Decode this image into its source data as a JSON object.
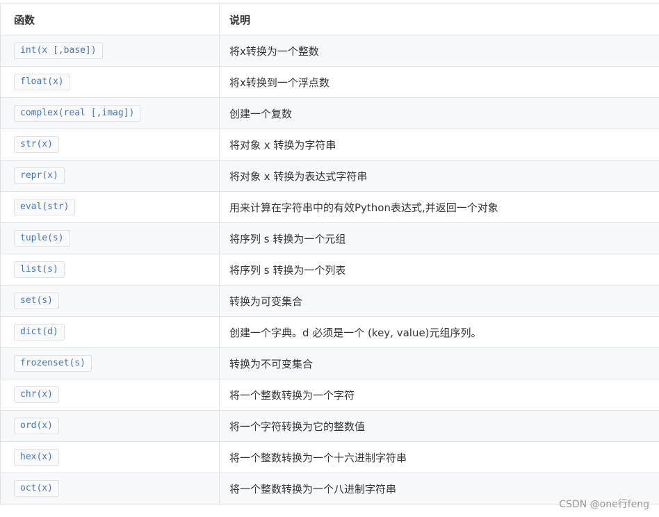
{
  "table": {
    "headers": {
      "function": "函数",
      "description": "说明"
    },
    "rows": [
      {
        "function": "int(x [,base])",
        "description": "将x转换为一个整数"
      },
      {
        "function": "float(x)",
        "description": "将x转换到一个浮点数"
      },
      {
        "function": "complex(real [,imag])",
        "description": "创建一个复数"
      },
      {
        "function": "str(x)",
        "description": "将对象 x 转换为字符串"
      },
      {
        "function": "repr(x)",
        "description": "将对象 x 转换为表达式字符串"
      },
      {
        "function": "eval(str)",
        "description": "用来计算在字符串中的有效Python表达式,并返回一个对象"
      },
      {
        "function": "tuple(s)",
        "description": "将序列 s 转换为一个元组"
      },
      {
        "function": "list(s)",
        "description": "将序列 s 转换为一个列表"
      },
      {
        "function": "set(s)",
        "description": "转换为可变集合"
      },
      {
        "function": "dict(d)",
        "description": "创建一个字典。d 必须是一个 (key, value)元组序列。"
      },
      {
        "function": "frozenset(s)",
        "description": "转换为不可变集合"
      },
      {
        "function": "chr(x)",
        "description": "将一个整数转换为一个字符"
      },
      {
        "function": "ord(x)",
        "description": "将一个字符转换为它的整数值"
      },
      {
        "function": "hex(x)",
        "description": "将一个整数转换为一个十六进制字符串"
      },
      {
        "function": "oct(x)",
        "description": "将一个整数转换为一个八进制字符串"
      }
    ]
  },
  "watermark": "CSDN @one行feng"
}
